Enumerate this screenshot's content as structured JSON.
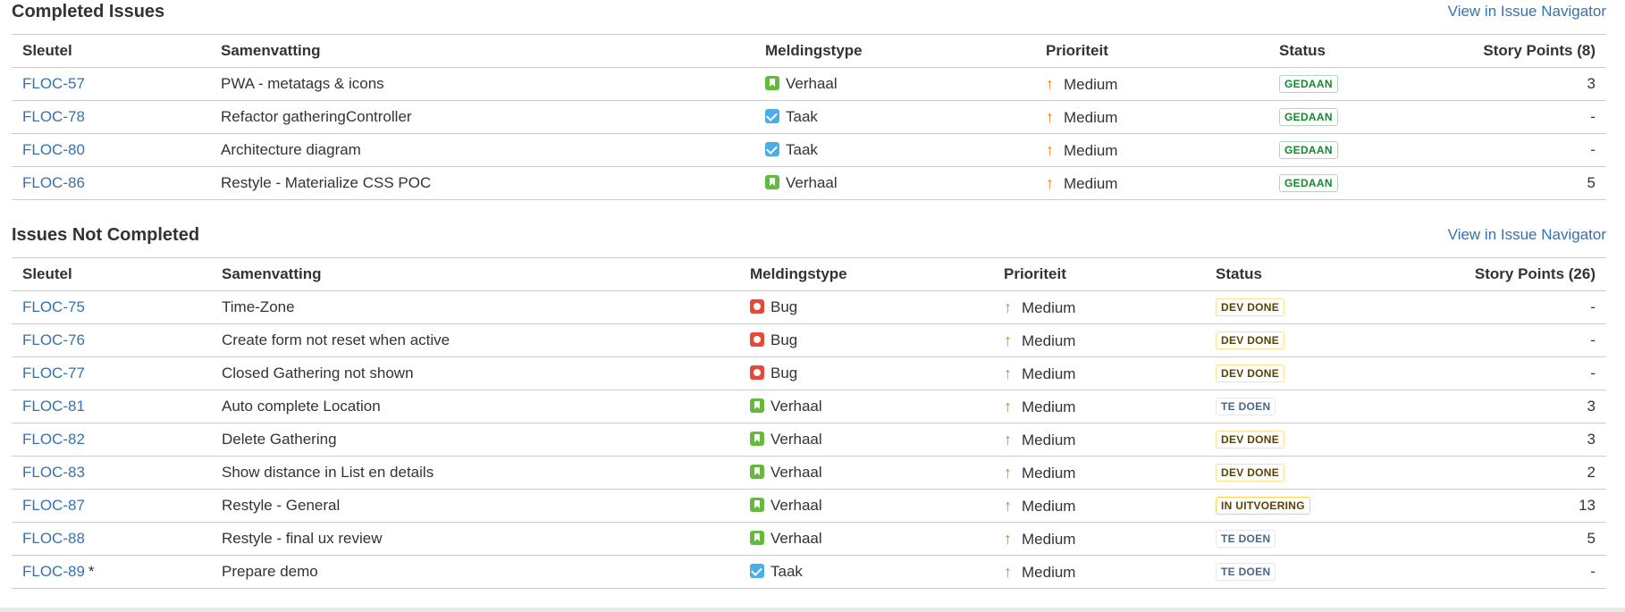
{
  "completed": {
    "title": "Completed Issues",
    "nav_link": "View in Issue Navigator",
    "headers": {
      "key": "Sleutel",
      "summary": "Samenvatting",
      "type": "Meldingstype",
      "priority": "Prioriteit",
      "status": "Status",
      "points": "Story Points (8)"
    },
    "rows": [
      {
        "key": "FLOC-57",
        "summary": "PWA - metatags & icons",
        "type": "Verhaal",
        "type_icon": "story-icon",
        "priority": "Medium",
        "status": "GEDAAN",
        "points": "3"
      },
      {
        "key": "FLOC-78",
        "summary": "Refactor gatheringController",
        "type": "Taak",
        "type_icon": "task-icon",
        "priority": "Medium",
        "status": "GEDAAN",
        "points": "-"
      },
      {
        "key": "FLOC-80",
        "summary": "Architecture diagram",
        "type": "Taak",
        "type_icon": "task-icon",
        "priority": "Medium",
        "status": "GEDAAN",
        "points": "-"
      },
      {
        "key": "FLOC-86",
        "summary": "Restyle - Materialize CSS POC",
        "type": "Verhaal",
        "type_icon": "story-icon",
        "priority": "Medium",
        "status": "GEDAAN",
        "points": "5"
      }
    ]
  },
  "not_completed": {
    "title": "Issues Not Completed",
    "nav_link": "View in Issue Navigator",
    "headers": {
      "key": "Sleutel",
      "summary": "Samenvatting",
      "type": "Meldingstype",
      "priority": "Prioriteit",
      "status": "Status",
      "points": "Story Points (26)"
    },
    "rows": [
      {
        "key": "FLOC-75",
        "asterisk": "",
        "summary": "Time-Zone",
        "type": "Bug",
        "type_icon": "bug-icon",
        "priority": "Medium",
        "status": "DEV DONE",
        "points": "-"
      },
      {
        "key": "FLOC-76",
        "asterisk": "",
        "summary": "Create form not reset when active",
        "type": "Bug",
        "type_icon": "bug-icon",
        "priority": "Medium",
        "status": "DEV DONE",
        "points": "-"
      },
      {
        "key": "FLOC-77",
        "asterisk": "",
        "summary": "Closed Gathering not shown",
        "type": "Bug",
        "type_icon": "bug-icon",
        "priority": "Medium",
        "status": "DEV DONE",
        "points": "-"
      },
      {
        "key": "FLOC-81",
        "asterisk": "",
        "summary": "Auto complete Location",
        "type": "Verhaal",
        "type_icon": "story-icon",
        "priority": "Medium",
        "status": "TE DOEN",
        "points": "3"
      },
      {
        "key": "FLOC-82",
        "asterisk": "",
        "summary": "Delete Gathering",
        "type": "Verhaal",
        "type_icon": "story-icon",
        "priority": "Medium",
        "status": "DEV DONE",
        "points": "3"
      },
      {
        "key": "FLOC-83",
        "asterisk": "",
        "summary": "Show distance in List en details",
        "type": "Verhaal",
        "type_icon": "story-icon",
        "priority": "Medium",
        "status": "DEV DONE",
        "points": "2"
      },
      {
        "key": "FLOC-87",
        "asterisk": "",
        "summary": "Restyle - General",
        "type": "Verhaal",
        "type_icon": "story-icon",
        "priority": "Medium",
        "status": "IN UITVOERING",
        "points": "13"
      },
      {
        "key": "FLOC-88",
        "asterisk": "",
        "summary": "Restyle - final ux review",
        "type": "Verhaal",
        "type_icon": "story-icon",
        "priority": "Medium",
        "status": "TE DOEN",
        "points": "5"
      },
      {
        "key": "FLOC-89",
        "asterisk": "*",
        "summary": "Prepare demo",
        "type": "Taak",
        "type_icon": "task-icon",
        "priority": "Medium",
        "status": "TE DOEN",
        "points": "-"
      }
    ]
  },
  "colors": {
    "link": "#3572b0",
    "story": "#63ba3c",
    "task": "#4bade8",
    "bug": "#e5493a",
    "priority_medium": "#f07d16",
    "status_done": "#14892c",
    "status_devdone": "#594300",
    "status_todo": "#4a6785"
  },
  "priority_icon": "arrow-up-icon"
}
